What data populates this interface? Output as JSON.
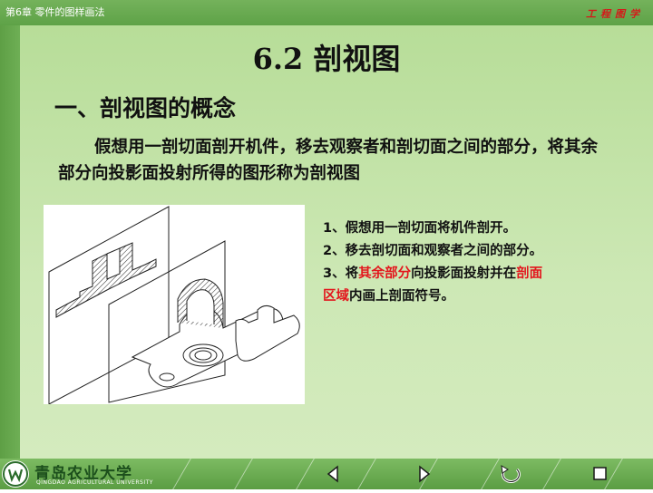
{
  "header": {
    "chapter": "第6章  零件的图样画法",
    "subject": "工程图学"
  },
  "slide": {
    "title": "6.2  剖视图",
    "heading": "一、剖视图的概念",
    "definition": "假想用一剖切面剖开机件，移去观察者和剖切面之间的部分，将其余部分向投影面投射所得的图形称为剖视图",
    "notes": {
      "line1": "1、假想用一剖切面将机件剖开。",
      "line2": "2、移去剖切面和观察者之间的部分。",
      "line3_prefix": "3、将",
      "line3_red1": "其余部分",
      "line3_mid": "向投影面投射并在",
      "line3_red2": "剖面",
      "line4_red": "区域",
      "line4_suffix": "内画上剖面符号。"
    }
  },
  "footer": {
    "university": "青岛农业大学",
    "university_en": "QINGDAO AGRICULTURAL UNIVERSITY"
  },
  "nav": {
    "buttons": [
      {
        "name": "previous-slide-button",
        "icon": "triangle-left-icon"
      },
      {
        "name": "next-slide-button",
        "icon": "triangle-right-icon"
      },
      {
        "name": "return-button",
        "icon": "circular-arrow-icon"
      },
      {
        "name": "end-show-button",
        "icon": "square-stop-icon"
      }
    ]
  },
  "colors": {
    "frame_green": "#5ea247",
    "content_green": "#cde8b5",
    "accent_red": "#e3151c"
  }
}
